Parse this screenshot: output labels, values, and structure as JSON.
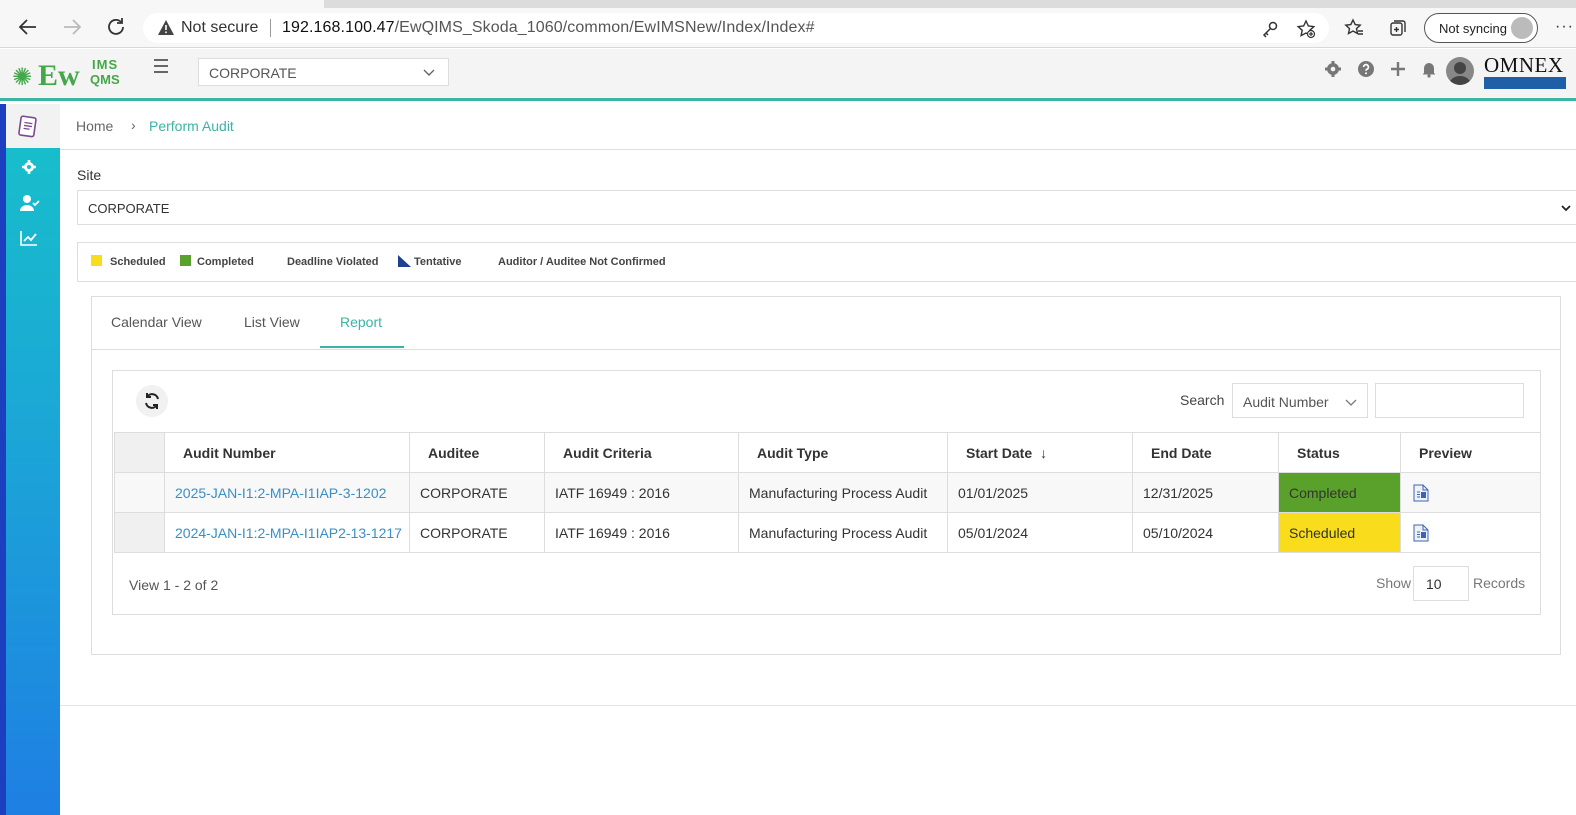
{
  "browser": {
    "not_secure": "Not secure",
    "url_host": "192.168.100.47",
    "url_path": "/EwQIMS_Skoda_1060/common/EwIMSNew/Index/Index#",
    "profile_label": "Not syncing",
    "more": "···"
  },
  "header": {
    "logo_ew": "Ew",
    "logo_ims": "IMS",
    "logo_qms": "QMS",
    "site_value": "CORPORATE",
    "brand": "OMNEX"
  },
  "breadcrumb": {
    "home": "Home",
    "sep": "›",
    "current": "Perform Audit"
  },
  "site": {
    "label": "Site",
    "value": "CORPORATE"
  },
  "legend": {
    "scheduled": "Scheduled",
    "completed": "Completed",
    "deadline_violated": "Deadline Violated",
    "tentative": "Tentative",
    "not_confirmed": "Auditor / Auditee Not Confirmed",
    "colors": {
      "scheduled": "#f9dc1b",
      "completed": "#5aa12b",
      "tentative": "#1f3f8f"
    }
  },
  "tabs": [
    {
      "label": "Calendar View",
      "active": false
    },
    {
      "label": "List View",
      "active": false
    },
    {
      "label": "Report",
      "active": true
    }
  ],
  "search": {
    "label": "Search",
    "field": "Audit Number",
    "value": ""
  },
  "table": {
    "columns": [
      "Audit Number",
      "Auditee",
      "Audit Criteria",
      "Audit Type",
      "Start Date",
      "End Date",
      "Status",
      "Preview"
    ],
    "sort_indicator": "↓",
    "rows": [
      {
        "audit_number": "2025-JAN-I1:2-MPA-I1IAP-3-1202",
        "auditee": "CORPORATE",
        "criteria": "IATF 16949 : 2016",
        "type": "Manufacturing Process Audit",
        "start": "01/01/2025",
        "end": "12/31/2025",
        "status": "Completed"
      },
      {
        "audit_number": "2024-JAN-I1:2-MPA-I1IAP2-13-1217",
        "auditee": "CORPORATE",
        "criteria": "IATF 16949 : 2016",
        "type": "Manufacturing Process Audit",
        "start": "05/01/2024",
        "end": "05/10/2024",
        "status": "Scheduled"
      }
    ]
  },
  "pager": {
    "view": "View 1 - 2 of 2",
    "show": "Show",
    "page_size": "10",
    "records": "Records"
  },
  "theme": {
    "accent": "#3bb3a5",
    "link": "#3a8fc7"
  }
}
